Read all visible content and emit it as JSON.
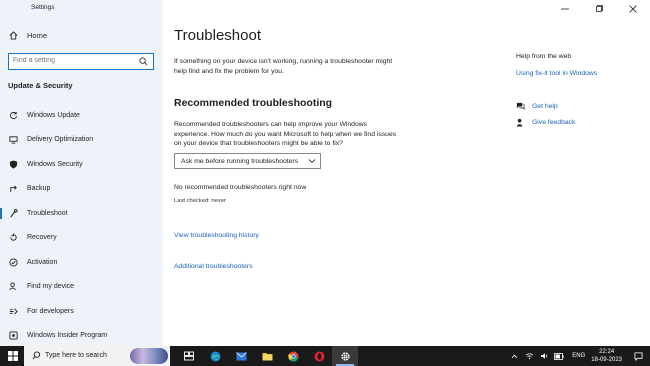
{
  "window": {
    "title": "Settings",
    "controls": [
      "minimize",
      "maximize",
      "close"
    ]
  },
  "sidebar": {
    "home_label": "Home",
    "search_placeholder": "Find a setting",
    "section_title": "Update & Security",
    "items": [
      {
        "label": "Windows Update",
        "icon": "sync-icon"
      },
      {
        "label": "Delivery Optimization",
        "icon": "delivery-icon"
      },
      {
        "label": "Windows Security",
        "icon": "shield-icon"
      },
      {
        "label": "Backup",
        "icon": "backup-arrow-icon"
      },
      {
        "label": "Troubleshoot",
        "icon": "wrench-icon",
        "active": true
      },
      {
        "label": "Recovery",
        "icon": "recovery-icon"
      },
      {
        "label": "Activation",
        "icon": "check-circle-icon"
      },
      {
        "label": "Find my device",
        "icon": "person-location-icon"
      },
      {
        "label": "For developers",
        "icon": "developer-icon"
      },
      {
        "label": "Windows Insider Program",
        "icon": "insider-icon"
      }
    ]
  },
  "main": {
    "title": "Troubleshoot",
    "intro": "If something on your device isn't working, running a troubleshooter might help find and fix the problem for you.",
    "recommended_heading": "Recommended troubleshooting",
    "recommended_desc": "Recommended troubleshooters can help improve your Windows experience. How much do you want Microsoft to help when we find issues on your device that troubleshooters might be able to fix?",
    "dropdown_value": "Ask me before running troubleshooters",
    "no_troubleshooters": "No recommended troubleshooters right now",
    "last_checked": "Last checked: never",
    "history_link": "View troubleshooting history",
    "additional_link": "Additional troubleshooters"
  },
  "right_panel": {
    "help_web_title": "Help from the web",
    "fixit_link": "Using fix-it tool in Windows",
    "get_help": "Get help",
    "give_feedback": "Give feedback"
  },
  "taskbar": {
    "search_text": "Type here to search",
    "apps": [
      "task-view-icon",
      "edge-icon",
      "mail-icon",
      "file-explorer-icon",
      "chrome-icon",
      "opera-icon",
      "settings-icon"
    ],
    "language": "ENG",
    "time": "22:24",
    "date": "18-09-2023"
  },
  "colors": {
    "accent": "#1a73c9",
    "link": "#1a64b8",
    "sidebar_bg": "#eef3f9",
    "taskbar_bg": "#1a1a1a"
  }
}
